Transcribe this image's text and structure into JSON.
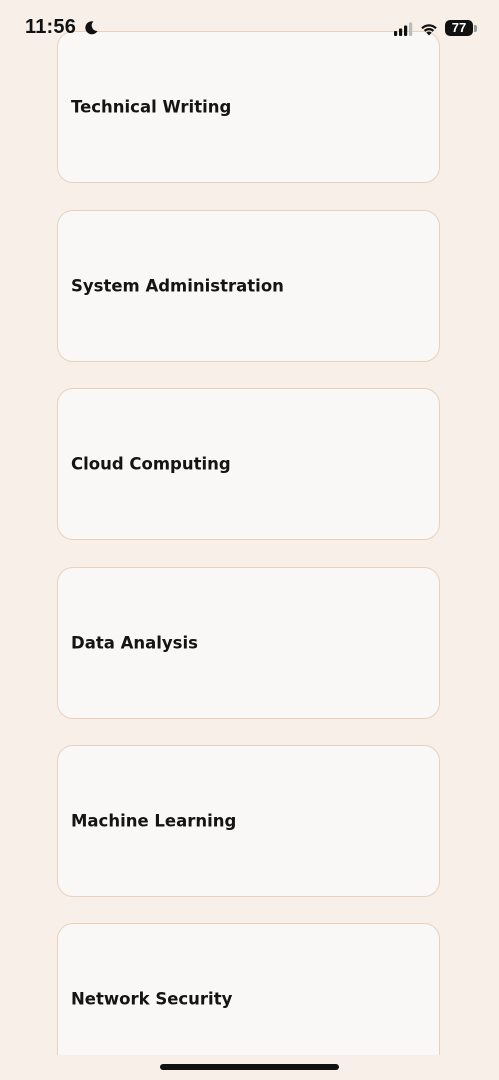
{
  "status_bar": {
    "time": "11:56",
    "battery_level": "77",
    "icons": [
      "moon-icon",
      "signal-icon",
      "wifi-icon",
      "battery-icon"
    ]
  },
  "topics": [
    {
      "label": "Technical Writing"
    },
    {
      "label": "System Administration"
    },
    {
      "label": "Cloud Computing"
    },
    {
      "label": "Data Analysis"
    },
    {
      "label": "Machine Learning"
    },
    {
      "label": "Network Security"
    }
  ],
  "colors": {
    "background": "#F7EFE8",
    "card_background": "#F9F8F6",
    "card_border": "#E8D2BE",
    "text": "#141414"
  }
}
